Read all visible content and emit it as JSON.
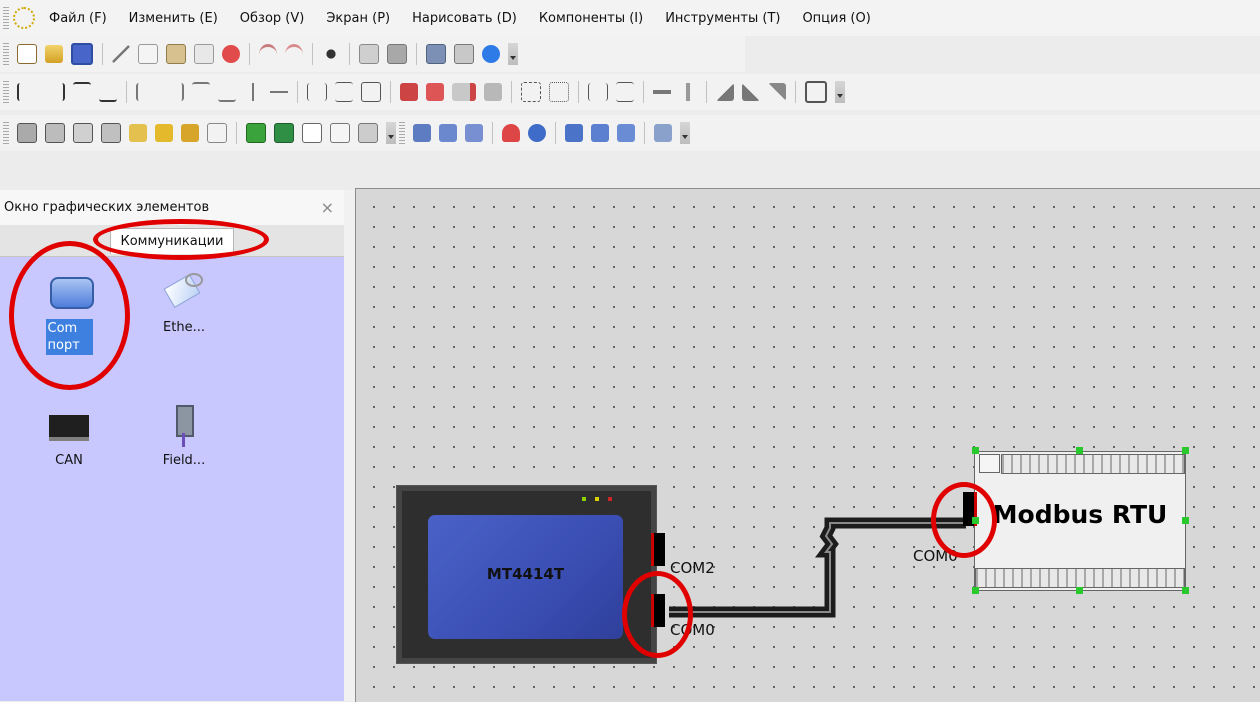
{
  "menu": {
    "items": [
      "Файл (F)",
      "Изменить (E)",
      "Обзор (V)",
      "Экран (P)",
      "Нарисовать (D)",
      "Компоненты (I)",
      "Инструменты (T)",
      "Опция (O)"
    ]
  },
  "toolbar1": {
    "icons": [
      "new-project-icon",
      "open-folder-icon",
      "save-icon",
      "cut-icon",
      "copy-icon",
      "paste-icon",
      "duplicate-icon",
      "delete-icon",
      "undo-icon",
      "redo-icon",
      "find-icon",
      "print-preview-icon",
      "print-icon",
      "project-properties-icon",
      "settings-icon",
      "help-icon"
    ]
  },
  "graphics_panel": {
    "title": "Окно графических элементов",
    "tab_label": "Коммуникации",
    "items": [
      {
        "label": "Com порт",
        "icon": "com-port-icon",
        "selected": true
      },
      {
        "label": "Ethe...",
        "icon": "ethernet-icon",
        "selected": false
      },
      {
        "label": "CAN",
        "icon": "can-icon",
        "selected": false
      },
      {
        "label": "Field...",
        "icon": "fieldbus-icon",
        "selected": false
      }
    ]
  },
  "canvas": {
    "hmi": {
      "model": "MT4414T",
      "ports": [
        "COM2",
        "COM0"
      ]
    },
    "plc": {
      "title": "Modbus RTU",
      "port_label": "COM0"
    }
  },
  "colors": {
    "panel_bg": "#c8c8ff",
    "highlight_ring": "#e00000",
    "selection_handle": "#29c92d",
    "selected_label_bg": "#3d80e0"
  }
}
